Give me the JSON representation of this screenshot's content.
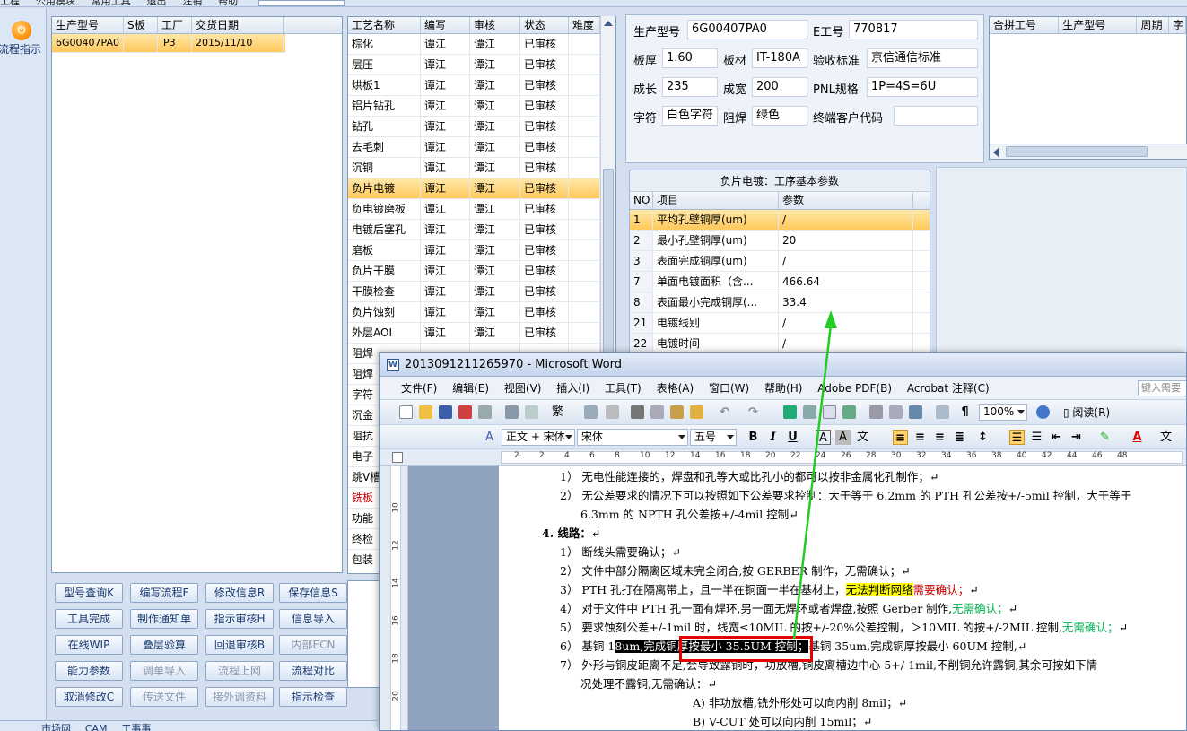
{
  "top_menu": [
    "工程",
    "公用模块",
    "常用工具",
    "退出",
    "注销",
    "帮助"
  ],
  "left_toolbar": {
    "flow_button_label": "流程指示",
    "flow_icon": "orange-circle-icon"
  },
  "product_grid": {
    "headers": [
      "生产型号",
      "S板",
      "工厂",
      "交货日期"
    ],
    "rows": [
      [
        "6G00407PA0",
        "",
        "P3",
        "2015/11/10"
      ]
    ],
    "selected_row": 0
  },
  "process_grid": {
    "headers": [
      "工艺名称",
      "编写",
      "审核",
      "状态",
      "难度"
    ],
    "rows": [
      [
        "棕化",
        "谭江",
        "谭江",
        "已审核",
        ""
      ],
      [
        "层压",
        "谭江",
        "谭江",
        "已审核",
        ""
      ],
      [
        "烘板1",
        "谭江",
        "谭江",
        "已审核",
        ""
      ],
      [
        "铝片钻孔",
        "谭江",
        "谭江",
        "已审核",
        ""
      ],
      [
        "钻孔",
        "谭江",
        "谭江",
        "已审核",
        ""
      ],
      [
        "去毛刺",
        "谭江",
        "谭江",
        "已审核",
        ""
      ],
      [
        "沉铜",
        "谭江",
        "谭江",
        "已审核",
        ""
      ],
      [
        "负片电镀",
        "谭江",
        "谭江",
        "已审核",
        ""
      ],
      [
        "负电镀磨板",
        "谭江",
        "谭江",
        "已审核",
        ""
      ],
      [
        "电镀后塞孔",
        "谭江",
        "谭江",
        "已审核",
        ""
      ],
      [
        "磨板",
        "谭江",
        "谭江",
        "已审核",
        ""
      ],
      [
        "负片干膜",
        "谭江",
        "谭江",
        "已审核",
        ""
      ],
      [
        "干膜检查",
        "谭江",
        "谭江",
        "已审核",
        ""
      ],
      [
        "负片蚀刻",
        "谭江",
        "谭江",
        "已审核",
        ""
      ],
      [
        "外层AOI",
        "谭江",
        "谭江",
        "已审核",
        ""
      ],
      [
        "阻焊",
        "",
        "",
        "",
        ""
      ],
      [
        "阻焊",
        "",
        "",
        "",
        ""
      ],
      [
        "字符",
        "",
        "",
        "",
        ""
      ],
      [
        "沉金",
        "",
        "",
        "",
        ""
      ],
      [
        "阻抗",
        "",
        "",
        "",
        ""
      ],
      [
        "电子",
        "",
        "",
        "",
        ""
      ],
      [
        "跳V槽",
        "",
        "",
        "",
        ""
      ],
      [
        "铣板",
        "",
        "",
        "",
        ""
      ],
      [
        "功能",
        "",
        "",
        "",
        ""
      ],
      [
        "终检",
        "",
        "",
        "",
        ""
      ],
      [
        "包装",
        "",
        "",
        "",
        ""
      ]
    ],
    "selected_row": 7,
    "red_row": 22
  },
  "buttons": [
    [
      "型号查询K",
      "编写流程F",
      "修改信息R",
      "保存信息S"
    ],
    [
      "工具完成",
      "制作通知单",
      "指示审核H",
      "信息导入"
    ],
    [
      "在线WIP",
      "叠层验算",
      "回退审核B",
      "内部ECN"
    ],
    [
      "能力参数",
      "调单导入",
      "流程上网",
      "流程对比"
    ],
    [
      "取消修改C",
      "传送文件",
      "接外调资料",
      "指示检查"
    ]
  ],
  "disabled_buttons": [
    "内部ECN",
    "调单导入",
    "流程上网",
    "传送文件",
    "接外调资料"
  ],
  "bottom_tabs": [
    "市场网",
    "CAM",
    "工事事"
  ],
  "info": {
    "prod_model_label": "生产型号",
    "prod_model": "6G00407PA0",
    "e_no_label": "E工号",
    "e_no": "770817",
    "thickness_label": "板厚",
    "thickness": "1.60",
    "material_label": "板材",
    "material": "IT-180A",
    "accept_label": "验收标准",
    "accept": "京信通信标准",
    "length_label": "成长",
    "length": "235",
    "width_label": "成宽",
    "width": "200",
    "pnl_label": "PNL规格",
    "pnl": "1P=4S=6U",
    "char_label": "字符",
    "char": "白色字符",
    "mask_label": "阻焊",
    "mask": "绿色",
    "customer_label": "终端客户代码",
    "customer": ""
  },
  "merge_grid": {
    "headers": [
      "合拼工号",
      "生产型号",
      "周期",
      "字"
    ]
  },
  "param_panel": {
    "title": "负片电镀：工序基本参数",
    "headers": [
      "NO",
      "项目",
      "参数"
    ],
    "rows": [
      [
        "1",
        "平均孔壁铜厚(um)",
        "/"
      ],
      [
        "2",
        "最小孔壁铜厚(um)",
        "20"
      ],
      [
        "3",
        "表面完成铜厚(um)",
        "/"
      ],
      [
        "7",
        "单面电镀面积（含...",
        "466.64"
      ],
      [
        "8",
        "表面最小完成铜厚(...",
        "33.4"
      ],
      [
        "21",
        "电镀线别",
        "/"
      ],
      [
        "22",
        "电镀时间",
        "/"
      ]
    ]
  },
  "word": {
    "title": "2013091211265970 - Microsoft Word",
    "menu": [
      "文件(F)",
      "编辑(E)",
      "视图(V)",
      "插入(I)",
      "工具(T)",
      "表格(A)",
      "窗口(W)",
      "帮助(H)",
      "Adobe PDF(B)",
      "Acrobat 注释(C)"
    ],
    "ask_placeholder": "键入需要",
    "zoom": "100%",
    "reading": "阅读(R)",
    "style": "正文 + 宋体",
    "font": "宋体",
    "size": "五号",
    "ruler_marks": [
      "2",
      "2",
      "4",
      "6",
      "8",
      "10",
      "12",
      "14",
      "16",
      "18",
      "20",
      "22",
      "24",
      "26",
      "28",
      "30",
      "32",
      "34",
      "36",
      "38",
      "40",
      "42",
      "44",
      "46",
      "48"
    ],
    "vruler_marks": [
      "10",
      "12",
      "14",
      "16",
      "18",
      "20"
    ],
    "doc": {
      "l1": "1）  无电性能连接的，焊盘和孔等大或比孔小的都可以按非金属化孔制作；↵",
      "l2": "2）  无公差要求的情况下可以按照如下公差要求控制：大于等于 6.2mm 的 PTH 孔公差按+/-5mil 控制，大于等于",
      "l3": "6.3mm 的 NPTH 孔公差按+/-4mil 控制↵",
      "h4": "4.   线路：↵",
      "l5": "1）  断线头需要确认；↵",
      "l6": "2）  文件中部分隔离区域未完全闭合,按 GERBER 制作，无需确认；↵",
      "l7a": "3）  PTH 孔打在隔离带上，且一半在铜面一半在基材上，",
      "l7b": "无法判断网络",
      "l7c": "需要确认；",
      "l7d": "↵",
      "l8a": "4）  对于文件中 PTH 孔一面有焊环,另一面无焊环或者焊盘,按照 Gerber 制作,",
      "l8b": "无需确认；",
      "l8c": "↵",
      "l9a": "5）  要求蚀刻公差+/-1mil 时，线宽≤10MIL 的按+/-20%公差控制，＞10MIL 的按+/-2MIL 控制,",
      "l9b": "无需确认；",
      "l9c": "↵",
      "l10a": "6）  基铜 1",
      "l10b": "8um,完成铜厚按最小 35.5UM 控制；",
      "l10c": "基铜 35um,完成铜厚按最小 60UM 控制,↵",
      "l11": "7）  外形与铜皮距离不足,会导致露铜时，功放槽,铜皮离槽边中心 5+/-1mil,不削铜允许露铜,其余可按如下情",
      "l12": "况处理不露铜,无需确认：↵",
      "l13": "A)   非功放槽,铣外形处可以向内削 8mil；↵",
      "l14": "B)   V-CUT 处可以向内削 15mil；↵"
    }
  },
  "colors": {
    "selection": "#ffc95c",
    "highlight": "#ffff00",
    "red_text": "#d00000",
    "green_text": "#00b050",
    "annotation_red": "#e60000",
    "arrow_green": "#22cc22"
  }
}
